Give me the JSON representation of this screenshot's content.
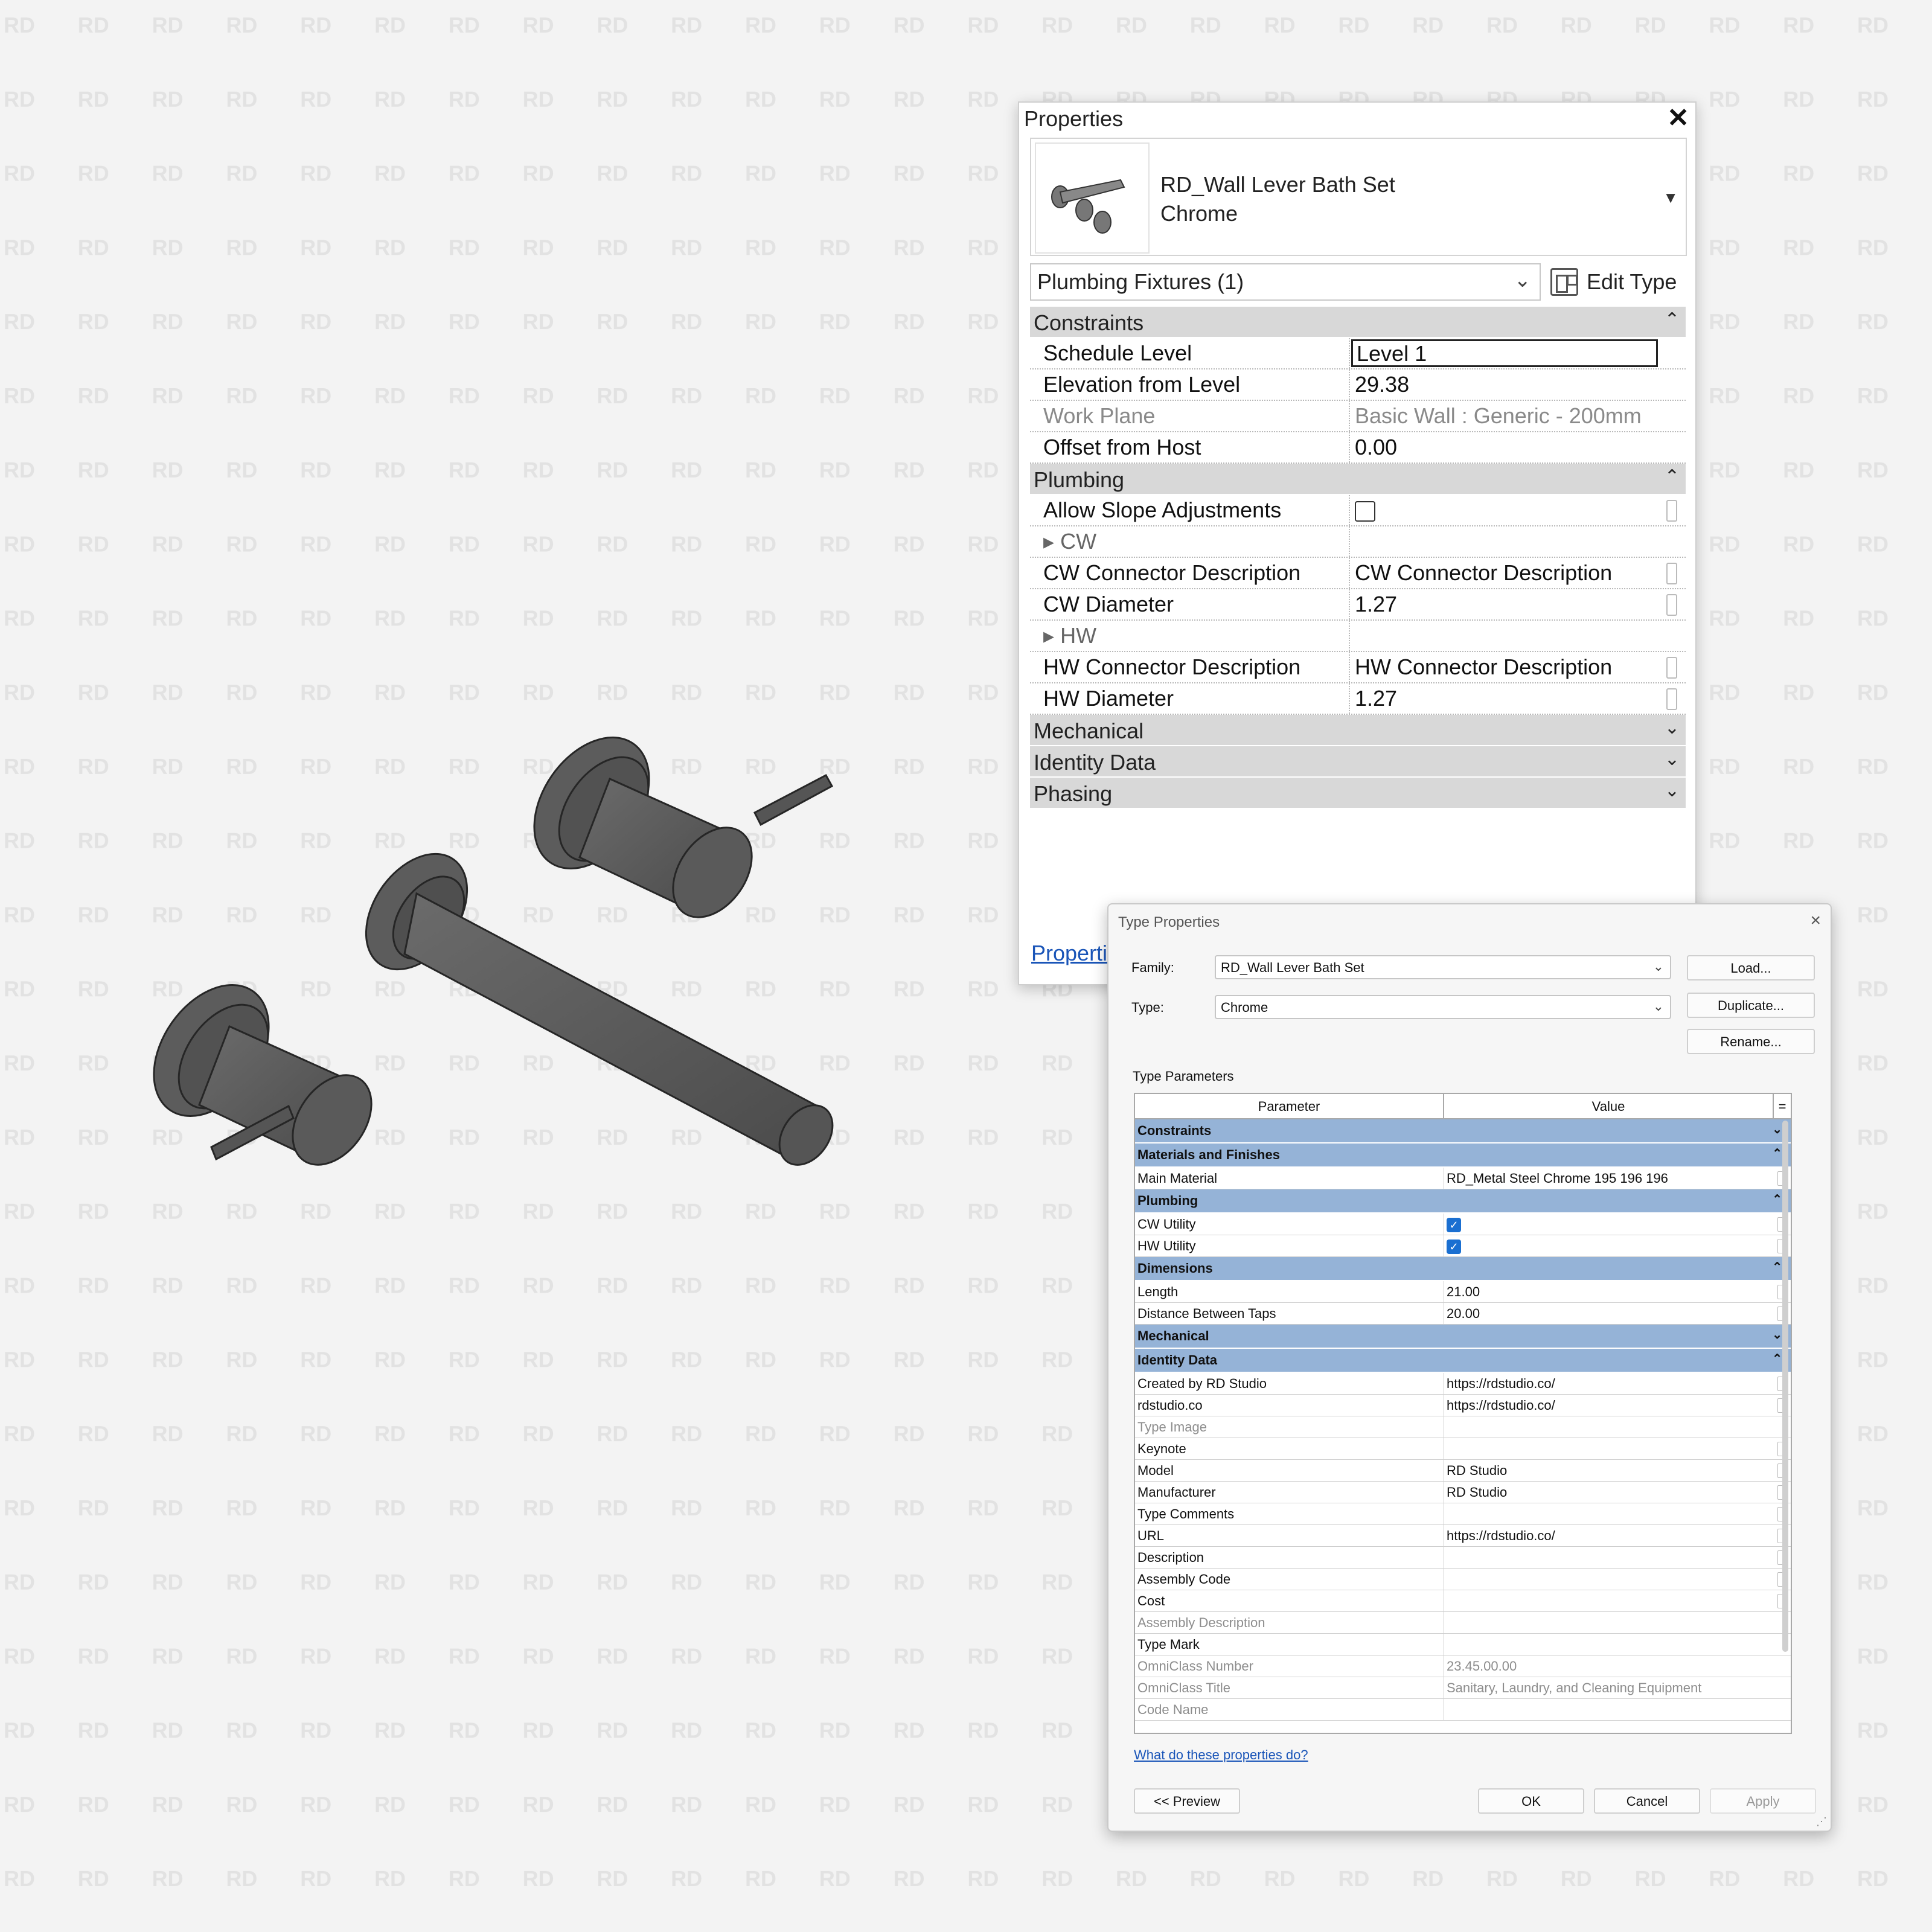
{
  "watermark": "RD",
  "properties": {
    "title": "Properties",
    "type_name_line1": "RD_Wall Lever Bath Set",
    "type_name_line2": "Chrome",
    "category_select": "Plumbing Fixtures (1)",
    "edit_type": "Edit Type",
    "groups": {
      "constraints": "Constraints",
      "plumbing": "Plumbing",
      "mechanical": "Mechanical",
      "identity": "Identity Data",
      "phasing": "Phasing"
    },
    "constraints_rows": [
      {
        "name": "Schedule Level",
        "value": "Level 1"
      },
      {
        "name": "Elevation from Level",
        "value": "29.38"
      },
      {
        "name": "Work Plane",
        "value": "Basic Wall : Generic - 200mm"
      },
      {
        "name": "Offset from Host",
        "value": "0.00"
      }
    ],
    "plumbing_rows": [
      {
        "name": "Allow Slope Adjustments",
        "value": ""
      },
      {
        "name": "CW",
        "value": ""
      },
      {
        "name": "CW Connector Description",
        "value": "CW Connector Description"
      },
      {
        "name": "CW Diameter",
        "value": "1.27"
      },
      {
        "name": "HW",
        "value": ""
      },
      {
        "name": "HW Connector Description",
        "value": "HW Connector Description"
      },
      {
        "name": "HW Diameter",
        "value": "1.27"
      }
    ],
    "help_link": "Properti"
  },
  "type_properties": {
    "title": "Type Properties",
    "close": "×",
    "family_label": "Family:",
    "family_value": "RD_Wall Lever Bath Set",
    "type_label": "Type:",
    "type_value": "Chrome",
    "load_button": "Load...",
    "duplicate_button": "Duplicate...",
    "rename_button": "Rename...",
    "section_label": "Type Parameters",
    "col_parameter": "Parameter",
    "col_value": "Value",
    "col_eq": "=",
    "groups": {
      "constraints": "Constraints",
      "materials": "Materials and Finishes",
      "plumbing": "Plumbing",
      "dimensions": "Dimensions",
      "mechanical": "Mechanical",
      "identity": "Identity Data"
    },
    "materials_rows": [
      {
        "name": "Main Material",
        "value": "RD_Metal Steel Chrome 195 196 196"
      }
    ],
    "plumbing_rows": [
      {
        "name": "CW Utility",
        "value": "✓"
      },
      {
        "name": "HW Utility",
        "value": "✓"
      }
    ],
    "dimensions_rows": [
      {
        "name": "Length",
        "value": "21.00"
      },
      {
        "name": "Distance Between Taps",
        "value": "20.00"
      }
    ],
    "identity_rows": [
      {
        "name": "Created by RD Studio",
        "value": "https://rdstudio.co/"
      },
      {
        "name": "rdstudio.co",
        "value": "https://rdstudio.co/"
      },
      {
        "name": "Type Image",
        "value": ""
      },
      {
        "name": "Keynote",
        "value": ""
      },
      {
        "name": "Model",
        "value": "RD Studio"
      },
      {
        "name": "Manufacturer",
        "value": "RD Studio"
      },
      {
        "name": "Type Comments",
        "value": ""
      },
      {
        "name": "URL",
        "value": "https://rdstudio.co/"
      },
      {
        "name": "Description",
        "value": ""
      },
      {
        "name": "Assembly Code",
        "value": ""
      },
      {
        "name": "Cost",
        "value": ""
      },
      {
        "name": "Assembly Description",
        "value": ""
      },
      {
        "name": "Type Mark",
        "value": ""
      },
      {
        "name": "OmniClass Number",
        "value": "23.45.00.00"
      },
      {
        "name": "OmniClass Title",
        "value": "Sanitary, Laundry, and Cleaning Equipment"
      },
      {
        "name": "Code Name",
        "value": ""
      }
    ],
    "help_link": "What do these properties do?",
    "preview_button": "<< Preview",
    "ok_button": "OK",
    "cancel_button": "Cancel",
    "apply_button": "Apply"
  }
}
